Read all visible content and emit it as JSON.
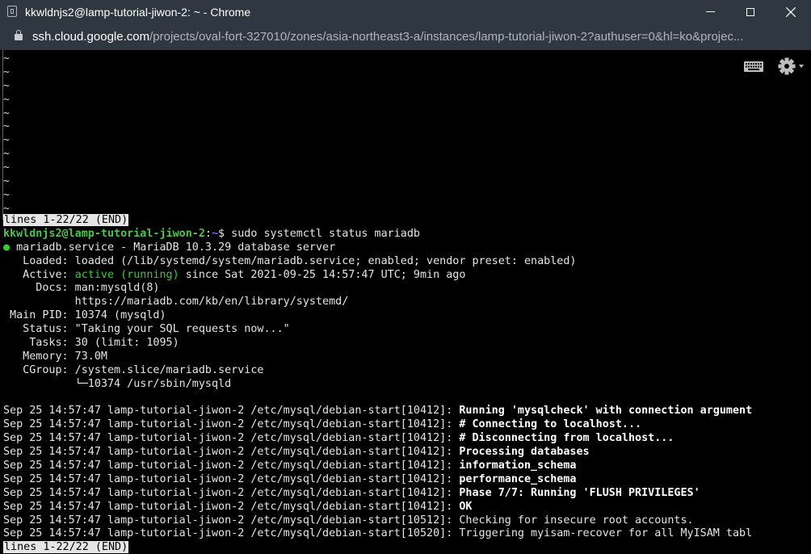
{
  "window": {
    "title": "kkwldnjs2@lamp-tutorial-jiwon-2: ~ - Chrome",
    "url_host": "ssh.cloud.google.com",
    "url_path": "/projects/oval-fort-327010/zones/asia-northeast3-a/instances/lamp-tutorial-jiwon-2?authuser=0&hl=ko&projec..."
  },
  "icons": {
    "app": "app-icon",
    "lock": "lock-icon",
    "keyboard": "keyboard-icon",
    "settings": "gear-icon"
  },
  "colors": {
    "chrome_bg": "#2f3740",
    "terminal_bg": "#000000",
    "prompt_green": "#4fc34f",
    "prompt_blue": "#5c7cff",
    "active_green": "#2fd12f"
  },
  "terminal": {
    "tilde": "~",
    "pager_status_top": "lines 1-22/22 (END)",
    "prompt_user": "kkwldnjs2@lamp-tutorial-jiwon-2",
    "prompt_sep": ":",
    "prompt_path": "~",
    "prompt_symbol": "$ ",
    "command": "sudo systemctl status mariadb",
    "service_dot": "●",
    "service_line": " mariadb.service - MariaDB 10.3.29 database server",
    "loaded_line": "   Loaded: loaded (/lib/systemd/system/mariadb.service; enabled; vendor preset: enabled)",
    "active_label": "   Active: ",
    "active_state": "active (running)",
    "active_rest": " since Sat 2021-09-25 14:57:47 UTC; 9min ago",
    "docs_line": "     Docs: man:mysqld(8)",
    "docs_line2": "           https://mariadb.com/kb/en/library/systemd/",
    "pid_line": " Main PID: 10374 (mysqld)",
    "status_line": "   Status: \"Taking your SQL requests now...\"",
    "tasks_line": "    Tasks: 30 (limit: 1095)",
    "memory_line": "   Memory: 73.0M",
    "cgroup_line": "   CGroup: /system.slice/mariadb.service",
    "cgroup_line2": "           └─10374 /usr/sbin/mysqld",
    "log_lines": [
      {
        "prefix": "Sep 25 14:57:47 lamp-tutorial-jiwon-2 /etc/mysql/debian-start[10412]: ",
        "msg": "Running 'mysqlcheck' with connection argument",
        "bold": true
      },
      {
        "prefix": "Sep 25 14:57:47 lamp-tutorial-jiwon-2 /etc/mysql/debian-start[10412]: ",
        "msg": "# Connecting to localhost...",
        "bold": true
      },
      {
        "prefix": "Sep 25 14:57:47 lamp-tutorial-jiwon-2 /etc/mysql/debian-start[10412]: ",
        "msg": "# Disconnecting from localhost...",
        "bold": true
      },
      {
        "prefix": "Sep 25 14:57:47 lamp-tutorial-jiwon-2 /etc/mysql/debian-start[10412]: ",
        "msg": "Processing databases",
        "bold": true
      },
      {
        "prefix": "Sep 25 14:57:47 lamp-tutorial-jiwon-2 /etc/mysql/debian-start[10412]: ",
        "msg": "information_schema",
        "bold": true
      },
      {
        "prefix": "Sep 25 14:57:47 lamp-tutorial-jiwon-2 /etc/mysql/debian-start[10412]: ",
        "msg": "performance_schema",
        "bold": true
      },
      {
        "prefix": "Sep 25 14:57:47 lamp-tutorial-jiwon-2 /etc/mysql/debian-start[10412]: ",
        "msg": "Phase 7/7: Running 'FLUSH PRIVILEGES'",
        "bold": true
      },
      {
        "prefix": "Sep 25 14:57:47 lamp-tutorial-jiwon-2 /etc/mysql/debian-start[10412]: ",
        "msg": "OK",
        "bold": true
      },
      {
        "prefix": "Sep 25 14:57:47 lamp-tutorial-jiwon-2 /etc/mysql/debian-start[10512]: ",
        "msg": "Checking for insecure root accounts.",
        "bold": false
      },
      {
        "prefix": "Sep 25 14:57:47 lamp-tutorial-jiwon-2 /etc/mysql/debian-start[10520]: ",
        "msg": "Triggering myisam-recover for all MyISAM tabl",
        "bold": false
      }
    ],
    "pager_status_bottom": "lines 1-22/22 (END)"
  }
}
